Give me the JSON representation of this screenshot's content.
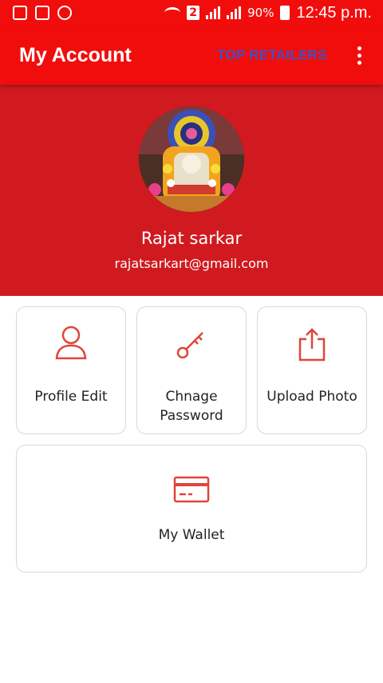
{
  "status_bar": {
    "sim_badge": "2",
    "battery": "90%",
    "time": "12:45 p.m."
  },
  "app_bar": {
    "title": "My Account",
    "action": "TOP RETAILERS"
  },
  "profile": {
    "name": "Rajat sarkar",
    "email": "rajatsarkart@gmail.com"
  },
  "menu": {
    "profile_edit": {
      "label": "Profile Edit",
      "icon": "user-icon"
    },
    "change_password": {
      "label": "Chnage Password",
      "icon": "key-icon"
    },
    "upload_photo": {
      "label": "Upload Photo",
      "icon": "share-upload-icon"
    },
    "wallet": {
      "label": "My Wallet",
      "icon": "credit-card-icon"
    }
  },
  "colors": {
    "app_bar": "#f20d0d",
    "header": "#d01a1f",
    "accent_icon": "#e0443a",
    "action_text": "#3b52c8"
  }
}
